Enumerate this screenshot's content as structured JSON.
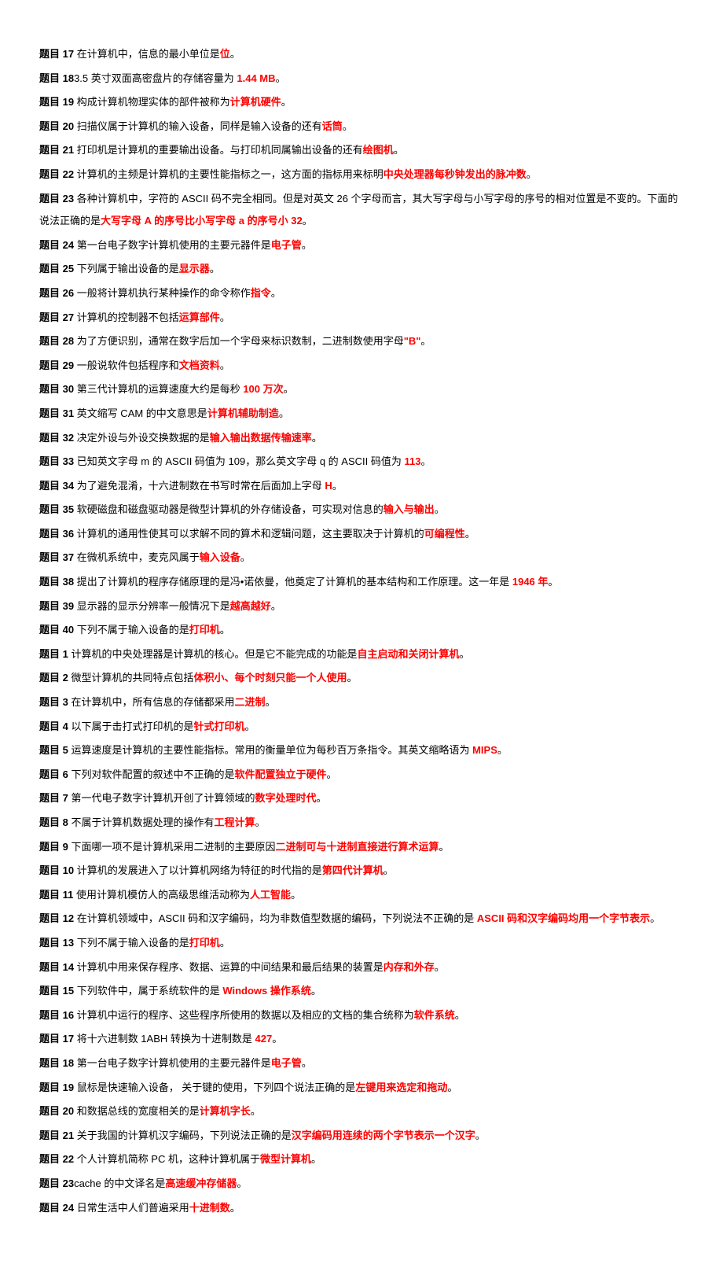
{
  "items": [
    {
      "label": "题目 17",
      "pre": " 在计算机中，信息的最小单位是",
      "ans": "位",
      "post": "。"
    },
    {
      "label": "题目 18",
      "pre": "3.5 英寸双面高密盘片的存储容量为 ",
      "ans": "1.44 MB",
      "post": "。"
    },
    {
      "label": "题目 19",
      "pre": " 构成计算机物理实体的部件被称为",
      "ans": "计算机硬件",
      "post": "。"
    },
    {
      "label": "题目 20",
      "pre": " 扫描仪属于计算机的输入设备，同样是输入设备的还有",
      "ans": "话筒",
      "post": "。"
    },
    {
      "label": "题目 21",
      "pre": " 打印机是计算机的重要输出设备。与打印机同属输出设备的还有",
      "ans": "绘图机",
      "post": "。"
    },
    {
      "label": "题目 22",
      "pre": " 计算机的主频是计算机的主要性能指标之一，这方面的指标用来标明",
      "ans": "中央处理器每秒钟发出的脉冲数",
      "post": "。"
    },
    {
      "label": "题目 23",
      "pre": " 各种计算机中，字符的 ASCII 码不完全相同。但是对英文 26 个字母而言，其大写字母与小写字母的序号的相对位置是不变的。下面的说法正确的是",
      "ans": "大写字母 A 的序号比小写字母 a 的序号小 32",
      "post": "。"
    },
    {
      "label": "题目 24",
      "pre": " 第一台电子数字计算机使用的主要元器件是",
      "ans": "电子管",
      "post": "。"
    },
    {
      "label": "题目 25",
      "pre": " 下列属于输出设备的是",
      "ans": "显示器",
      "post": "。"
    },
    {
      "label": "题目 26",
      "pre": " 一般将计算机执行某种操作的命令称作",
      "ans": "指令",
      "post": "。"
    },
    {
      "label": "题目 27",
      "pre": " 计算机的控制器不包括",
      "ans": "运算部件",
      "post": "。"
    },
    {
      "label": "题目 28",
      "pre": " 为了方便识别，通常在数字后加一个字母来标识数制，二进制数使用字母",
      "ans": "\"B\"",
      "post": "。"
    },
    {
      "label": "题目 29",
      "pre": " 一般说软件包括程序和",
      "ans": "文档资料",
      "post": "。"
    },
    {
      "label": "题目 30",
      "pre": " 第三代计算机的运算速度大约是每秒 ",
      "ans": "100 万次",
      "post": "。"
    },
    {
      "label": "题目 31",
      "pre": " 英文缩写 CAM 的中文意思是",
      "ans": "计算机辅助制造",
      "post": "。"
    },
    {
      "label": "题目 32",
      "pre": " 决定外设与外设交换数据的是",
      "ans": "输入输出数据传输速率",
      "post": "。"
    },
    {
      "label": "题目 33",
      "pre": " 已知英文字母 m 的 ASCII 码值为 109，那么英文字母 q 的 ASCII 码值为 ",
      "ans": "113",
      "post": "。"
    },
    {
      "label": "题目 34",
      "pre": " 为了避免混淆，十六进制数在书写时常在后面加上字母 ",
      "ans": "H",
      "post": "。"
    },
    {
      "label": "题目 35",
      "pre": " 软硬磁盘和磁盘驱动器是微型计算机的外存储设备，可实现对信息的",
      "ans": "输入与输出",
      "post": "。"
    },
    {
      "label": "题目 36",
      "pre": " 计算机的通用性使其可以求解不同的算术和逻辑问题，这主要取决于计算机的",
      "ans": "可编程性",
      "post": "。"
    },
    {
      "label": "题目 37",
      "pre": " 在微机系统中，麦克风属于",
      "ans": "输入设备",
      "post": "。"
    },
    {
      "label": "题目 38",
      "pre": " 提出了计算机的程序存储原理的是冯•诺依曼，他奠定了计算机的基本结构和工作原理。这一年是 ",
      "ans": "1946 年",
      "post": "。"
    },
    {
      "label": "题目 39",
      "pre": " 显示器的显示分辨率一般情况下是",
      "ans": "越高越好",
      "post": "。"
    },
    {
      "label": "题目 40",
      "pre": " 下列不属于输入设备的是",
      "ans": "打印机",
      "post": "。"
    },
    {
      "label": "题目 1",
      "pre": " 计算机的中央处理器是计算机的核心。但是它不能完成的功能是",
      "ans": "自主启动和关闭计算机",
      "post": "。"
    },
    {
      "label": "题目 2",
      "pre": " 微型计算机的共同特点包括",
      "ans": "体积小、每个时刻只能一个人使用",
      "post": "。"
    },
    {
      "label": "题目 3",
      "pre": " 在计算机中，所有信息的存储都采用",
      "ans": "二进制",
      "post": "。"
    },
    {
      "label": "题目 4",
      "pre": " 以下属于击打式打印机的是",
      "ans": "针式打印机",
      "post": "。"
    },
    {
      "label": "题目 5",
      "pre": " 运算速度是计算机的主要性能指标。常用的衡量单位为每秒百万条指令。其英文缩略语为 ",
      "ans": "MIPS",
      "post": "。"
    },
    {
      "label": "题目 6",
      "pre": " 下列对软件配置的叙述中不正确的是",
      "ans": "软件配置独立于硬件",
      "post": "。"
    },
    {
      "label": "题目 7",
      "pre": " 第一代电子数字计算机开创了计算领域的",
      "ans": "数字处理时代",
      "post": "。"
    },
    {
      "label": "题目 8",
      "pre": " 不属于计算机数据处理的操作有",
      "ans": "工程计算",
      "post": "。"
    },
    {
      "label": "题目 9",
      "pre": " 下面哪一项不是计算机采用二进制的主要原因",
      "ans": "二进制可与十进制直接进行算术运算",
      "post": "。"
    },
    {
      "label": "题目 10",
      "pre": " 计算机的发展进入了以计算机网络为特征的时代指的是",
      "ans": "第四代计算机",
      "post": "。"
    },
    {
      "label": "题目 11",
      "pre": " 使用计算机模仿人的高级思维活动称为",
      "ans": "人工智能",
      "post": "。"
    },
    {
      "label": "题目 12",
      "pre": " 在计算机领域中，ASCII 码和汉字编码，均为非数值型数据的编码，下列说法不正确的是 ",
      "ans": "ASCII 码和汉字编码均用一个字节表示",
      "post": "。"
    },
    {
      "label": "题目 13",
      "pre": " 下列不属于输入设备的是",
      "ans": "打印机",
      "post": "。"
    },
    {
      "label": "题目 14",
      "pre": " 计算机中用来保存程序、数据、运算的中间结果和最后结果的装置是",
      "ans": "内存和外存",
      "post": "。"
    },
    {
      "label": "题目 15",
      "pre": " 下列软件中，属于系统软件的是 ",
      "ans": "Windows 操作系统",
      "post": "。"
    },
    {
      "label": "题目 16",
      "pre": " 计算机中运行的程序、这些程序所使用的数据以及相应的文档的集合统称为",
      "ans": "软件系统",
      "post": "。"
    },
    {
      "label": "题目 17",
      "pre": " 将十六进制数 1ABH 转换为十进制数是 ",
      "ans": "427",
      "post": "。"
    },
    {
      "label": "题目 18",
      "pre": " 第一台电子数字计算机使用的主要元器件是",
      "ans": "电子管",
      "post": "。"
    },
    {
      "label": "题目 19",
      "pre": " 鼠标是快速输入设备，  关于键的使用，下列四个说法正确的是",
      "ans": "左键用来选定和拖动",
      "post": "。"
    },
    {
      "label": "题目 20",
      "pre": " 和数据总线的宽度相关的是",
      "ans": "计算机字长",
      "post": "。"
    },
    {
      "label": "题目 21",
      "pre": " 关于我国的计算机汉字编码，下列说法正确的是",
      "ans": "汉字编码用连续的两个字节表示一个汉字",
      "post": "。"
    },
    {
      "label": "题目 22",
      "pre": " 个人计算机简称 PC 机，这种计算机属于",
      "ans": "微型计算机",
      "post": "。"
    },
    {
      "label": "题目 23",
      "pre": "cache 的中文译名是",
      "ans": "高速缓冲存储器",
      "post": "。"
    },
    {
      "label": "题目 24",
      "pre": " 日常生活中人们普遍采用",
      "ans": "十进制数",
      "post": "。"
    }
  ]
}
